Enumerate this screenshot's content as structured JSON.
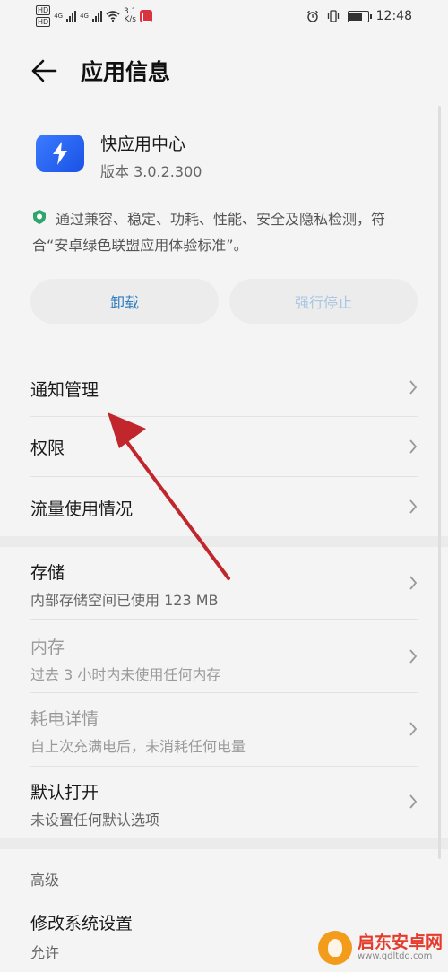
{
  "statusbar": {
    "hd1": "HD",
    "hd2": "HD",
    "net1": "4G",
    "net2": "4G",
    "speed_value": "3.1",
    "speed_unit": "K/s",
    "time": "12:48"
  },
  "header": {
    "title": "应用信息"
  },
  "app": {
    "name": "快应用中心",
    "version": "版本 3.0.2.300",
    "certification": "通过兼容、稳定、功耗、性能、安全及隐私检测，符合“安卓绿色联盟应用体验标准”。"
  },
  "buttons": {
    "uninstall": "卸载",
    "force_stop": "强行停止"
  },
  "items": [
    {
      "label": "通知管理"
    },
    {
      "label": "权限"
    },
    {
      "label": "流量使用情况"
    },
    {
      "label": "存储",
      "sub": "内部存储空间已使用 123 MB"
    },
    {
      "label": "内存",
      "sub": "过去 3 小时内未使用任何内存"
    },
    {
      "label": "耗电详情",
      "sub": "自上次充满电后，未消耗任何电量"
    },
    {
      "label": "默认打开",
      "sub": "未设置任何默认选项"
    }
  ],
  "advanced": {
    "title": "高级",
    "items": [
      {
        "label": "修改系统设置",
        "sub": "允许"
      }
    ]
  },
  "watermark": {
    "name": "启东安卓网",
    "url": "www.qdltdq.com"
  },
  "colors": {
    "accent": "#2e7dbf",
    "annotation": "#c0262c",
    "app_icon": "#2a62f0"
  }
}
